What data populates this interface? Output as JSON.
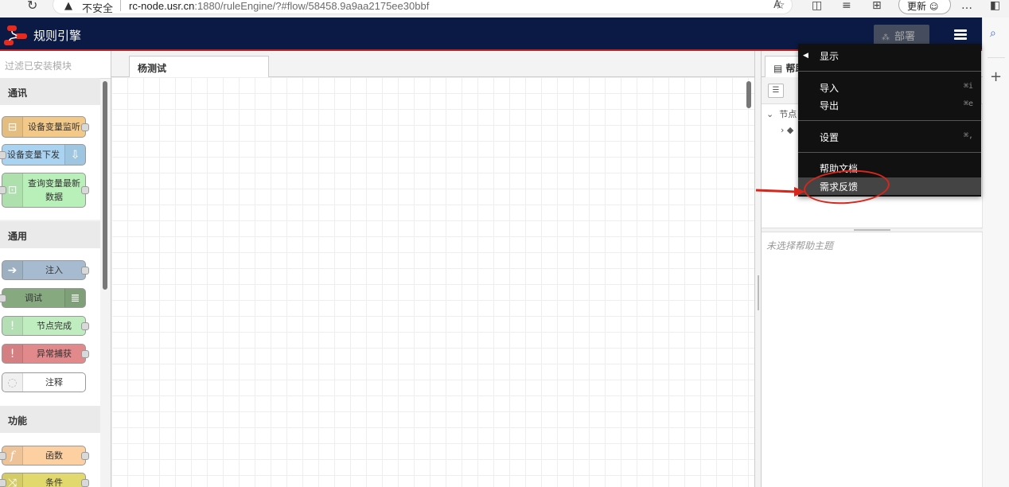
{
  "browser": {
    "security_label": "不安全",
    "url_host": "rc-node.usr.cn",
    "url_rest": ":1880/ruleEngine/?#flow/58458.9a9aa2175ee30bbf",
    "update_label": "更新"
  },
  "header": {
    "title": "规则引擎",
    "deploy_label": "部署"
  },
  "palette": {
    "filter_placeholder": "过滤已安装模块",
    "categories": [
      {
        "label": "通讯"
      },
      {
        "label": "通用"
      },
      {
        "label": "功能"
      }
    ],
    "nodes": [
      {
        "label": "设备变量监听",
        "color": "#f3c98a"
      },
      {
        "label": "设备变量下发",
        "color": "#a9d3f0"
      },
      {
        "label": "查询变量最新数据",
        "color": "#b9efb8"
      },
      {
        "label": "注入",
        "color": "#a6bbcf"
      },
      {
        "label": "调试",
        "color": "#87a980"
      },
      {
        "label": "节点完成",
        "color": "#c0edc0"
      },
      {
        "label": "异常捕获",
        "color": "#e2898b"
      },
      {
        "label": "注释",
        "color": "#ffffff"
      },
      {
        "label": "函数",
        "color": "#fdd0a2"
      },
      {
        "label": "条件",
        "color": "#e2d96e"
      }
    ]
  },
  "workspace": {
    "tab_label": "杨测试"
  },
  "sidebar": {
    "tab_label": "帮助",
    "tree_root": "节点",
    "help_empty": "未选择帮助主题"
  },
  "menu": {
    "items": [
      {
        "label": "显示",
        "shortcut": ""
      },
      {
        "label": "导入",
        "shortcut": "⌘i"
      },
      {
        "label": "导出",
        "shortcut": "⌘e"
      },
      {
        "label": "设置",
        "shortcut": "⌘,"
      },
      {
        "label": "帮助文档",
        "shortcut": ""
      },
      {
        "label": "需求反馈",
        "shortcut": ""
      }
    ]
  },
  "colors": {
    "header_bg": "#0b1a44",
    "header_accent": "#c02020",
    "annotation": "#d8261c"
  }
}
